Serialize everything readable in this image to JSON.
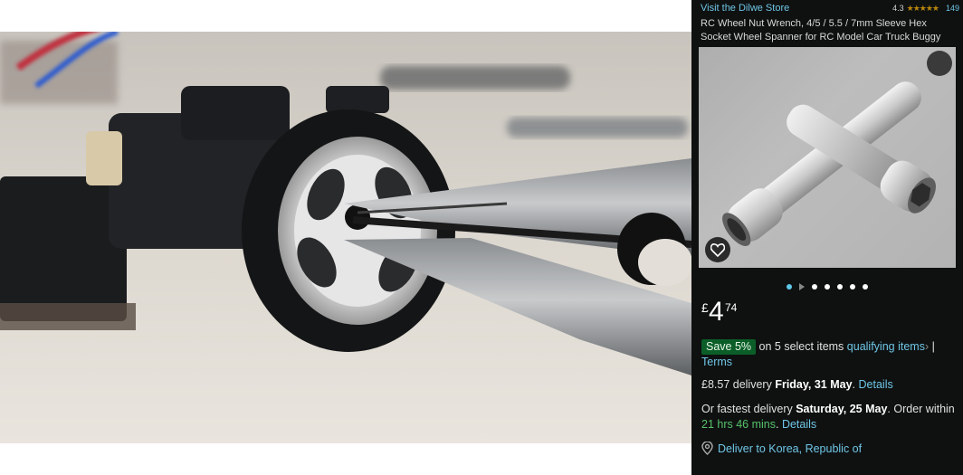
{
  "store": {
    "link_label": "Visit the Dilwe Store",
    "rating": "4.3",
    "stars": "★★★★★",
    "review_count": "149"
  },
  "product": {
    "title": "RC Wheel Nut Wrench, 4/5 / 5.5 / 7mm Sleeve Hex Socket Wheel Spanner for RC Model Car Truck Buggy",
    "wishlist_icon": "heart-icon",
    "image_count": 6,
    "current_image": 1
  },
  "price": {
    "currency": "£",
    "whole": "4",
    "fraction": "74"
  },
  "promo": {
    "badge": "Save 5%",
    "text": "on 5 select items",
    "link": "qualifying items",
    "chevron": "›",
    "separator": "|",
    "terms": "Terms"
  },
  "delivery": {
    "cost": "£8.57 delivery",
    "date": "Friday, 31 May",
    "period": ".",
    "details": "Details"
  },
  "fastest": {
    "prefix": "Or fastest delivery",
    "date": "Saturday, 25 May",
    "middle": ". Order within",
    "countdown": "21 hrs 46 mins",
    "period": ".",
    "details": "Details"
  },
  "location": {
    "icon": "location-pin-icon",
    "label": "Deliver to Korea, Republic of"
  },
  "colors": {
    "panel_bg": "#0f1111",
    "link": "#6fc6e6",
    "save_badge": "#0b5e28",
    "countdown": "#56c26a",
    "active_dot": "#5fc8e8"
  }
}
